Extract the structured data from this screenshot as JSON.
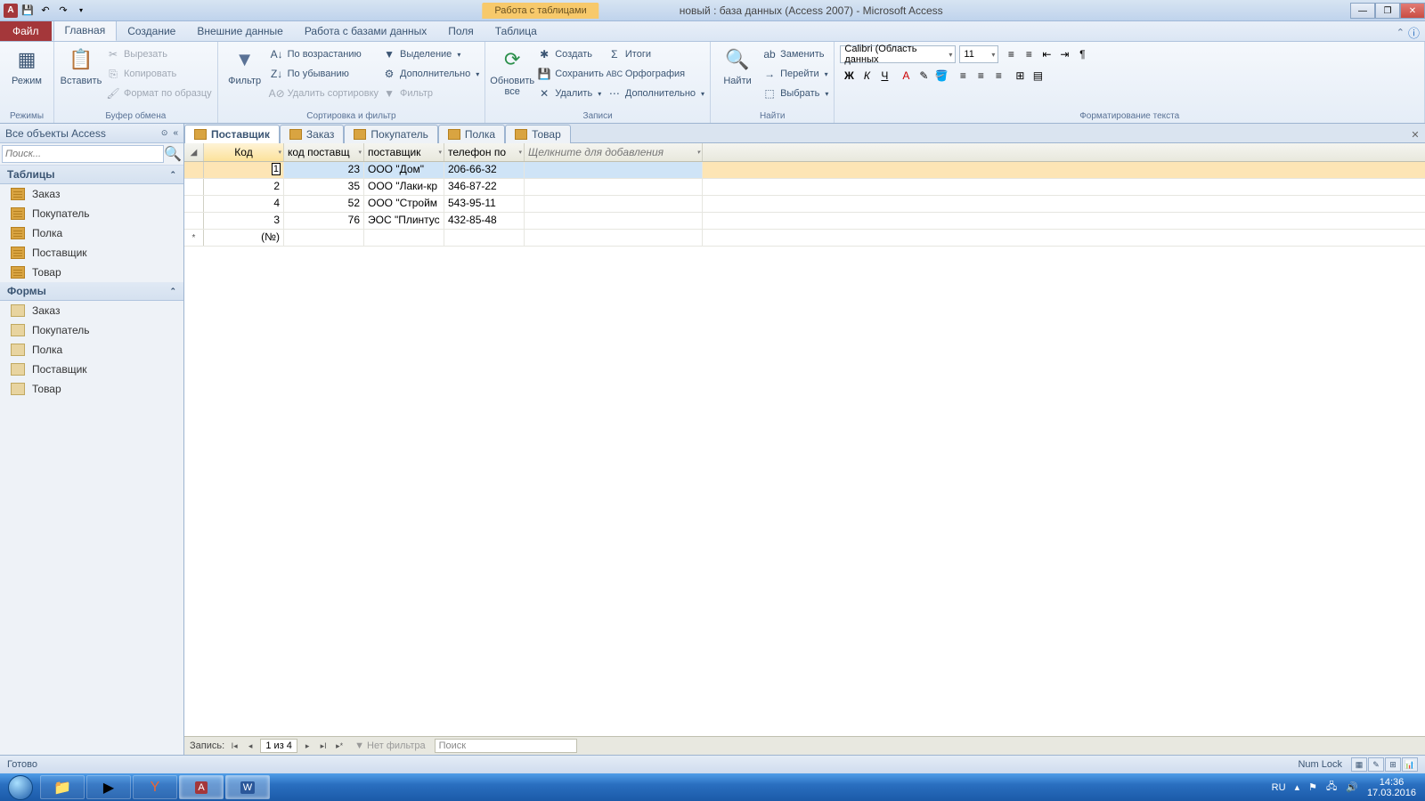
{
  "titlebar": {
    "context_tab": "Работа с таблицами",
    "title": "новый : база данных (Access 2007)  -  Microsoft Access"
  },
  "ribbon_tabs": {
    "file": "Файл",
    "items": [
      "Главная",
      "Создание",
      "Внешние данные",
      "Работа с базами данных",
      "Поля",
      "Таблица"
    ],
    "active": 0
  },
  "ribbon": {
    "groups": {
      "views": {
        "label": "Режимы",
        "btn": "Режим"
      },
      "clipboard": {
        "label": "Буфер обмена",
        "paste": "Вставить",
        "cut": "Вырезать",
        "copy": "Копировать",
        "format": "Формат по образцу"
      },
      "sort": {
        "label": "Сортировка и фильтр",
        "filter": "Фильтр",
        "asc": "По возрастанию",
        "desc": "По убыванию",
        "clear": "Удалить сортировку",
        "selection": "Выделение",
        "advanced": "Дополнительно",
        "toggle": "Фильтр"
      },
      "records": {
        "label": "Записи",
        "refresh": "Обновить все",
        "new": "Создать",
        "save": "Сохранить",
        "delete": "Удалить",
        "totals": "Итоги",
        "spell": "Орфография",
        "more": "Дополнительно"
      },
      "find": {
        "label": "Найти",
        "find": "Найти",
        "replace": "Заменить",
        "goto": "Перейти",
        "select": "Выбрать"
      },
      "format": {
        "label": "Форматирование текста",
        "font": "Calibri (Область данных",
        "size": "11"
      }
    }
  },
  "navpane": {
    "title": "Все объекты Access",
    "search_placeholder": "Поиск...",
    "sections": {
      "tables": {
        "label": "Таблицы",
        "items": [
          "Заказ",
          "Покупатель",
          "Полка",
          "Поставщик",
          "Товар"
        ]
      },
      "forms": {
        "label": "Формы",
        "items": [
          "Заказ",
          "Покупатель",
          "Полка",
          "Поставщик",
          "Товар"
        ]
      }
    }
  },
  "doctabs": {
    "items": [
      "Поставщик",
      "Заказ",
      "Покупатель",
      "Полка",
      "Товар"
    ],
    "active": 0
  },
  "grid": {
    "columns": [
      "Код",
      "код поставщ",
      "поставщик",
      "телефон по"
    ],
    "add_col": "Щелкните для добавления",
    "rows": [
      {
        "id": "1",
        "code": "23",
        "name": "ООО \"Дом\"",
        "phone": "206-66-32"
      },
      {
        "id": "2",
        "code": "35",
        "name": "ООО \"Лаки-кр",
        "phone": "346-87-22"
      },
      {
        "id": "4",
        "code": "52",
        "name": "ООО \"Стройм",
        "phone": "543-95-11"
      },
      {
        "id": "3",
        "code": "76",
        "name": "ЭОС \"Плинтус",
        "phone": "432-85-48"
      }
    ],
    "new_row": "(№)"
  },
  "recnav": {
    "label": "Запись:",
    "pos": "1 из 4",
    "nofilter": "Нет фильтра",
    "search": "Поиск"
  },
  "statusbar": {
    "ready": "Готово",
    "numlock": "Num Lock"
  },
  "taskbar": {
    "lang": "RU",
    "time": "14:36",
    "date": "17.03.2016"
  }
}
